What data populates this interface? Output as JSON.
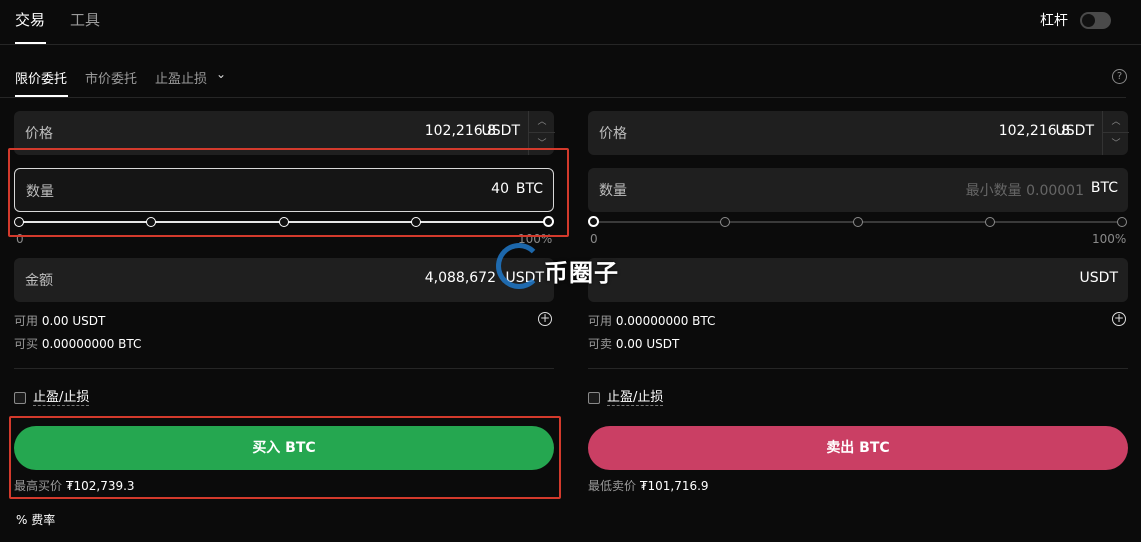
{
  "nav": {
    "tabs": [
      "交易",
      "工具"
    ],
    "leverage_label": "杠杆"
  },
  "order_tabs": {
    "limit": "限价委托",
    "market": "市价委托",
    "tpsl": "止盈止损",
    "chevron_icon": "chevron-down-icon"
  },
  "buy": {
    "price_label": "价格",
    "price_value": "102,216.8",
    "price_unit": "USDT",
    "qty_label": "数量",
    "qty_value": "40",
    "qty_unit": "BTC",
    "slider_level_pct": 100,
    "slider_min": "0",
    "slider_max": "100%",
    "amount_label": "金额",
    "amount_value": "4,088,672",
    "amount_unit": "USDT",
    "avail_label": "可用",
    "avail_value": "0.00 USDT",
    "canbuy_label": "可买",
    "canbuy_value": "0.00000000 BTC",
    "tpsl_label": "止盈/止损",
    "button_label": "买入 BTC",
    "best_label": "最高买价",
    "best_value": "₮102,739.3"
  },
  "sell": {
    "price_label": "价格",
    "price_value": "102,216.8",
    "price_unit": "USDT",
    "qty_label": "数量",
    "qty_placeholder": "最小数量 0.00001",
    "qty_unit": "BTC",
    "slider_level_pct": 0,
    "slider_min": "0",
    "slider_max": "100%",
    "amount_unit": "USDT",
    "avail_label": "可用",
    "avail_value": "0.00000000 BTC",
    "cansell_label": "可卖",
    "cansell_value": "0.00 USDT",
    "tpsl_label": "止盈/止损",
    "button_label": "卖出 BTC",
    "best_label": "最低卖价",
    "best_value": "₮101,716.9"
  },
  "fee": {
    "icon": "%",
    "label": "费率"
  },
  "watermark": {
    "text": "币圈子"
  },
  "colors": {
    "buy": "#25a750",
    "sell": "#ca3f64",
    "highlight": "#d33a2c"
  }
}
